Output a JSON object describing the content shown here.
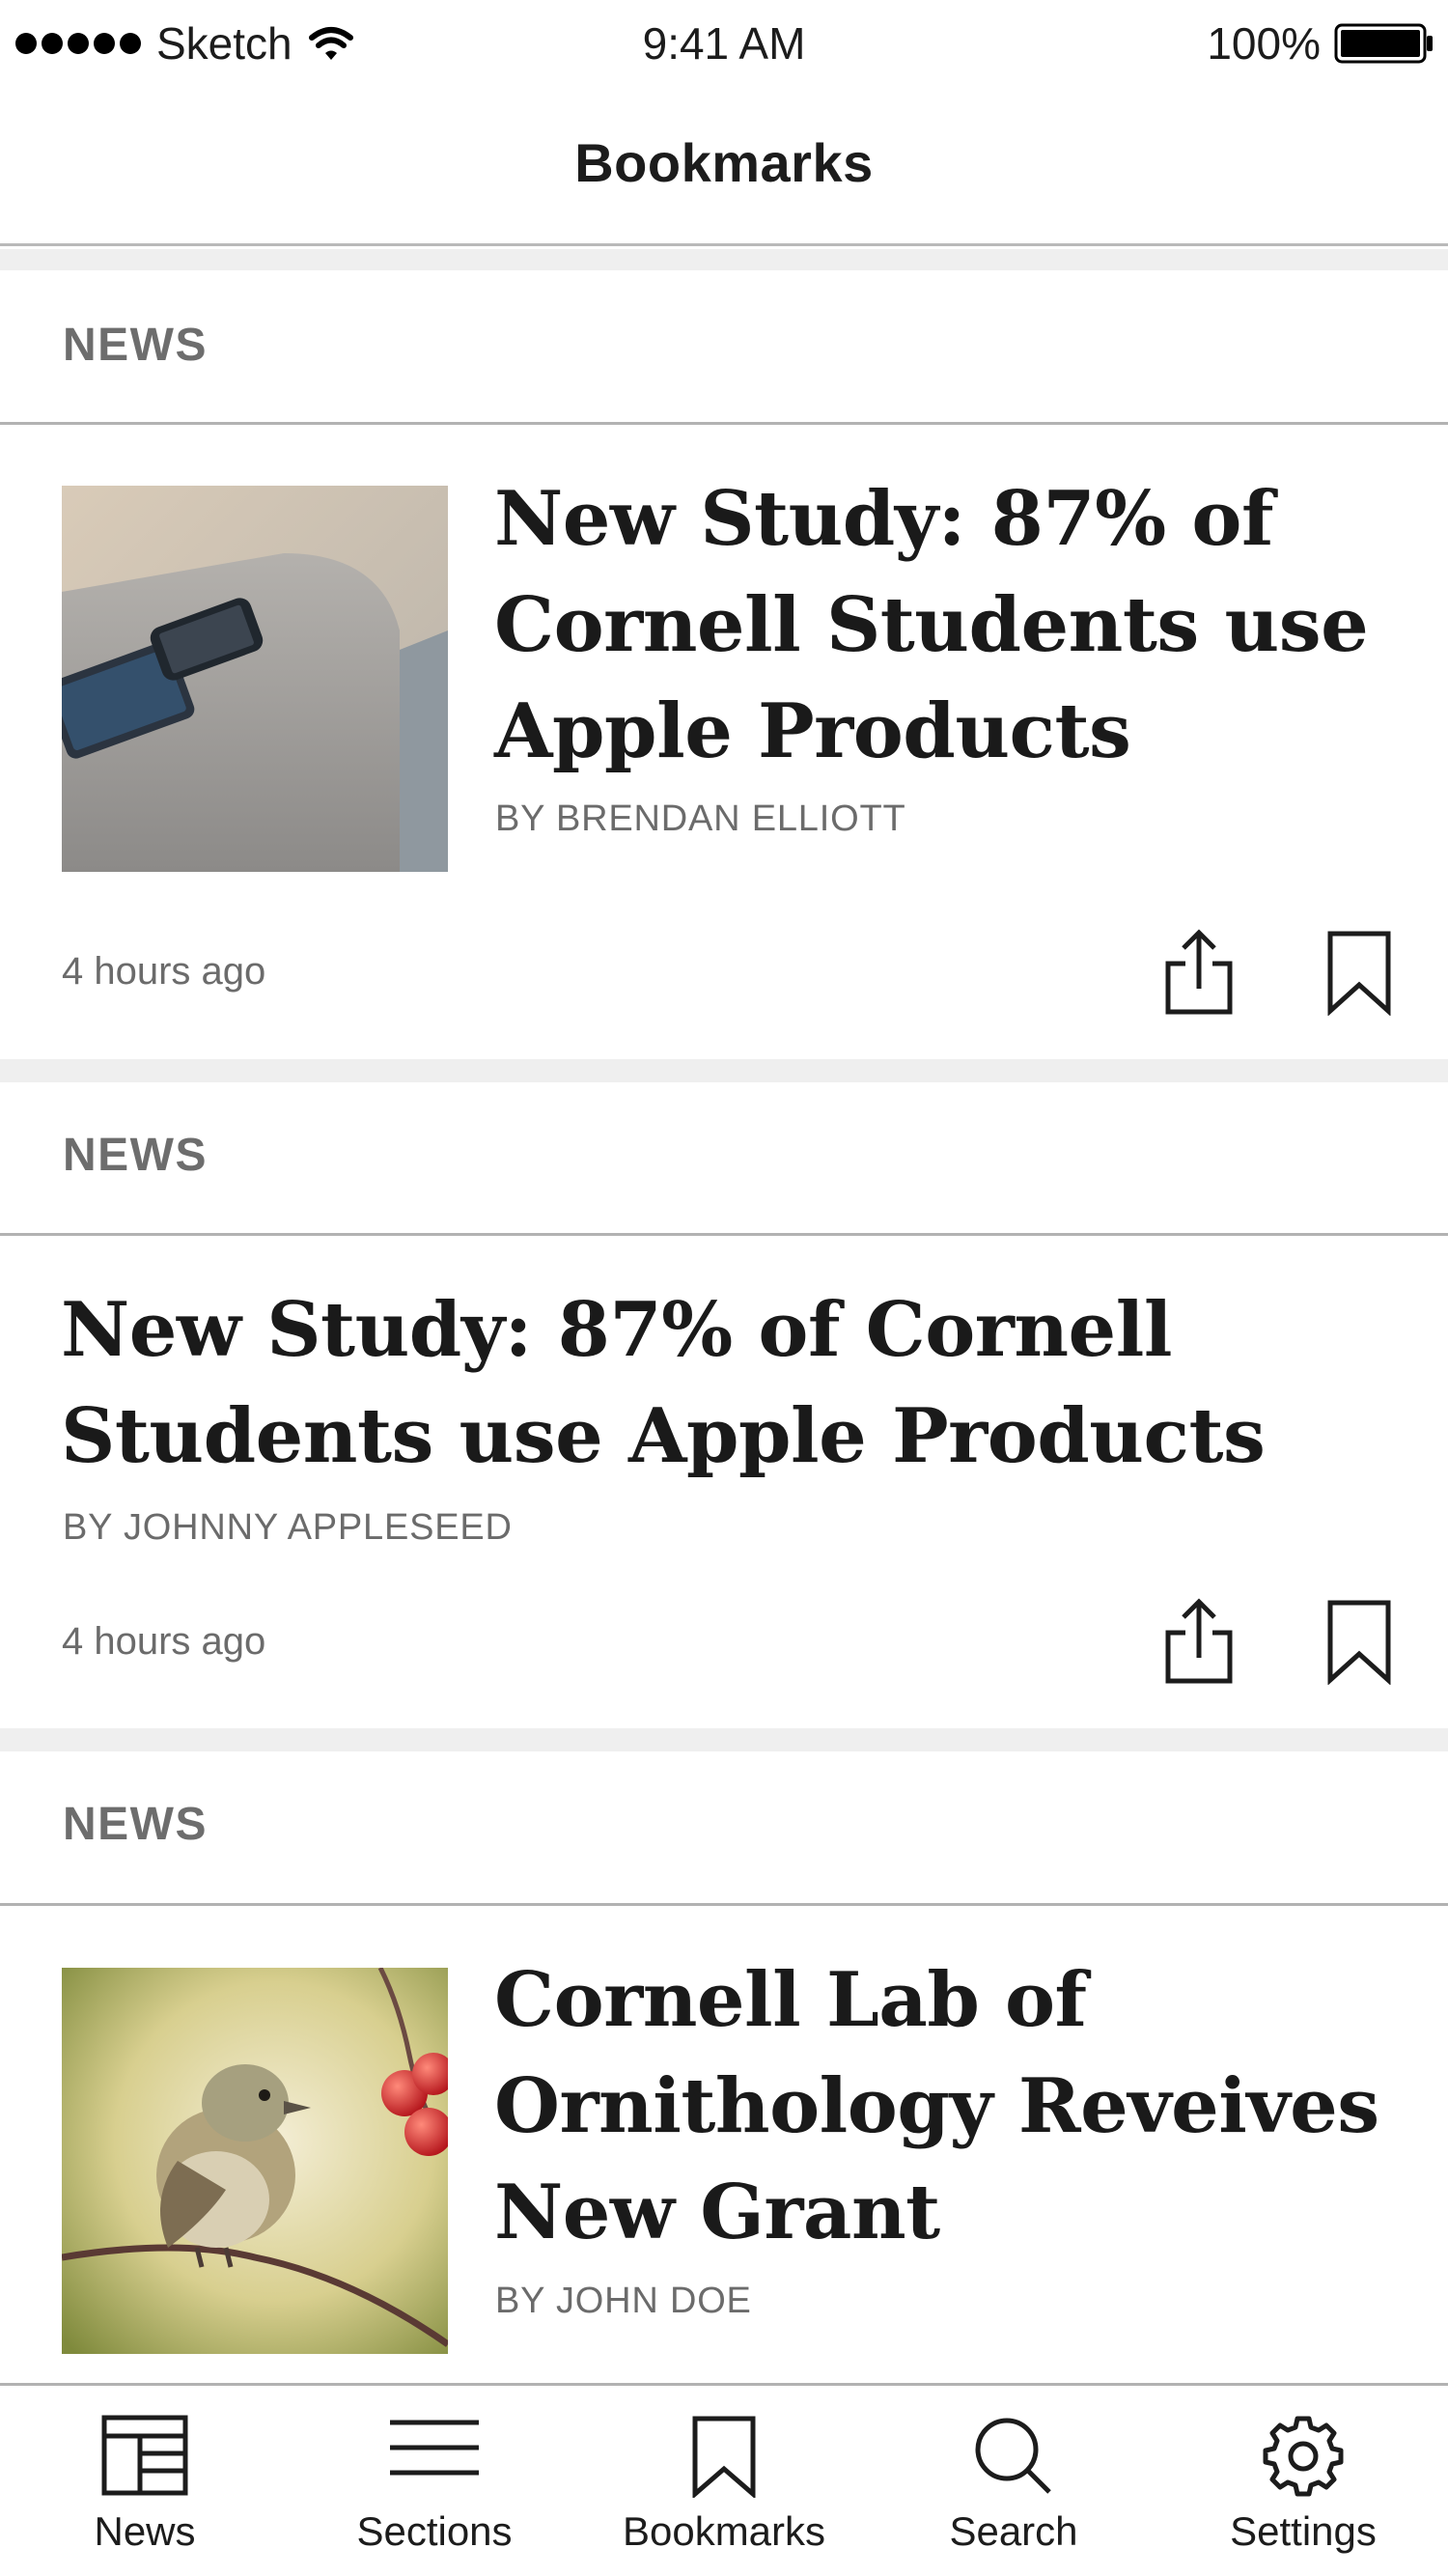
{
  "status_bar": {
    "carrier": "Sketch",
    "time": "9:41 AM",
    "battery": "100%"
  },
  "nav": {
    "title": "Bookmarks"
  },
  "articles": [
    {
      "section": "NEWS",
      "headline_lines": [
        "New Study: 87% of",
        "Cornell Students use",
        "Apple Products"
      ],
      "byline": "BY BRENDAN ELLIOTT",
      "time": "4 hours ago",
      "image": "phones-on-couch"
    },
    {
      "section": "NEWS",
      "headline_lines": [
        "New Study: 87% of Cornell",
        "Students use Apple Products"
      ],
      "byline": "BY JOHNNY APPLESEED",
      "time": "4 hours ago"
    },
    {
      "section": "NEWS",
      "headline_lines": [
        "Cornell Lab of",
        "Ornithology Reveives",
        "New Grant"
      ],
      "byline": "BY JOHN DOE",
      "image": "bird-on-branch"
    }
  ],
  "tabs": [
    {
      "label": "News",
      "icon": "newspaper-icon"
    },
    {
      "label": "Sections",
      "icon": "list-icon"
    },
    {
      "label": "Bookmarks",
      "icon": "bookmark-icon"
    },
    {
      "label": "Search",
      "icon": "search-icon"
    },
    {
      "label": "Settings",
      "icon": "gear-icon"
    }
  ]
}
